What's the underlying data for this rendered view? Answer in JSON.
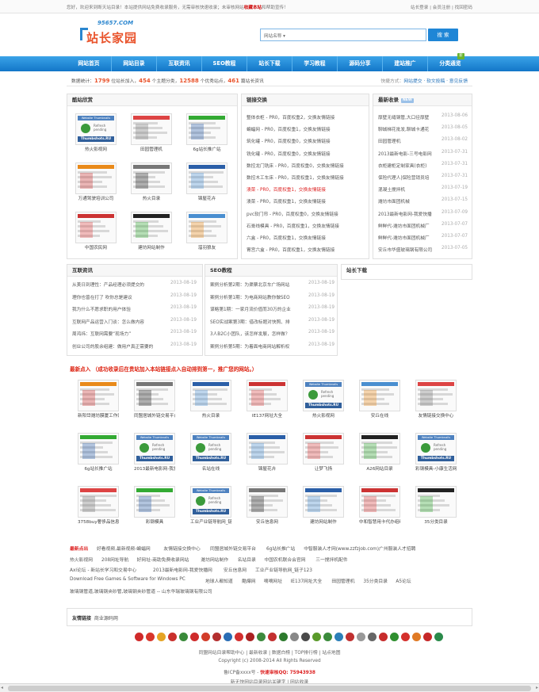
{
  "topbar": {
    "message_pre": "您好，欢迎来到断天站目录！本站提供网站免费收录服务，无需审核快速收录；未审核网站",
    "message_hl": "收藏本站",
    "message_post": "和帮助宣传！",
    "links": "站长登录 | 会员注册 | 找回密码"
  },
  "logo": {
    "url": "95657.COM",
    "name": "站长家园"
  },
  "search": {
    "select_label": "网站名称 ▾",
    "placeholder": "",
    "button": "搜 索"
  },
  "nav": [
    "网站首页",
    "网站目录",
    "互联资讯",
    "SEO教程",
    "站长下载",
    "学习教程",
    "源码分享",
    "建站推广",
    "分类通览"
  ],
  "nav_badge": "新",
  "stats": {
    "prefix": "数据统计：",
    "sites": "1799",
    "sites_label": "位站长加入，",
    "cats": "454",
    "cats_label": "个主题分类，",
    "excellent": "12588",
    "excellent_label": "个优秀站点，",
    "articles": "461",
    "articles_label": "篇站长资讯",
    "quick_label": "快捷方式：",
    "quick_links": "网站提交 · 软文投稿 · 意见反馈"
  },
  "cool_sites": {
    "title": "酷站欣赏",
    "items": [
      "热火影视网",
      "田园管理机",
      "6g站长推广站",
      "万通驾驶培训公司",
      "热火目录",
      "锦屋花卉",
      "中国农民网",
      "建坊网站制作",
      "溜羽狼友"
    ]
  },
  "link_exchange": {
    "title": "链接交换",
    "items": [
      {
        "t": "整体衣柜 - PR0，百度权重2，交换友情链接",
        "red": false
      },
      {
        "t": "蝙蝠网 - PR0，百度权重1，交换友情链接",
        "red": false
      },
      {
        "t": "筑化罐 - PR0，百度权重0，交换友情链接",
        "red": false
      },
      {
        "t": "铣化罐 - PR0，百度权重0，交换友情链接",
        "red": false
      },
      {
        "t": "数控龙门铣床 - PR0，百度权重0，交换友情链接",
        "red": false
      },
      {
        "t": "数控木工车床 - PR0，百度权重1，交换友情链接",
        "red": false
      },
      {
        "t": "溃菜 - PR0，百度权重1，交换友情链接",
        "red": true
      },
      {
        "t": "溃菜 - PR0，百度权重1，交换友情链接",
        "red": false
      },
      {
        "t": "pvc软门帘 - PR0，百度权重0，交换友情链接",
        "red": false
      },
      {
        "t": "石膏线模具 - PR0，百度权重1，交换友情链接",
        "red": false
      },
      {
        "t": "六盒 - PR0，百度权重1，交换友情链接",
        "red": false
      },
      {
        "t": "胃宫六盒 - PR0，百度权重1，交换友情链接",
        "red": false
      }
    ]
  },
  "newest": {
    "title": "最新收录",
    "tag": "NEW",
    "items": [
      {
        "t": "厚壁无缝钢管,大口径厚壁",
        "d": "2013-08-06"
      },
      {
        "t": "聊城梯花批发,聊城卡通花",
        "d": "2013-08-05"
      },
      {
        "t": "田园管理机",
        "d": "2013-08-02"
      },
      {
        "t": "2013最新电影-三号电影网",
        "d": "2013-07-31"
      },
      {
        "t": "衣柜建柜定制家具(衣柜)",
        "d": "2013-07-31"
      },
      {
        "t": "保险代理人|保险营销员培",
        "d": "2013-07-31"
      },
      {
        "t": "混凝土搅拌机",
        "d": "2013-07-19"
      },
      {
        "t": "潍坊市面团机械",
        "d": "2013-07-15"
      },
      {
        "t": "2013最新电影网-我爱快播",
        "d": "2013-07-09"
      },
      {
        "t": "鲜鲜代-潍坊市面团机械厂",
        "d": "2013-07-07"
      },
      {
        "t": "鲜鲜代-潍坊市面团机械厂",
        "d": "2013-07-07"
      },
      {
        "t": "安丘市华盛玻璃钢有限公司",
        "d": "2013-07-05"
      }
    ]
  },
  "news": {
    "title": "互联资讯",
    "items": [
      {
        "t": "从美日到理性：产品经理必须提交的",
        "d": "2013-08-19"
      },
      {
        "t": "理你也曾在打了 吹你总是建议",
        "d": "2013-08-19"
      },
      {
        "t": "我为什么不愿求职的用户体验",
        "d": "2013-08-19"
      },
      {
        "t": "互联网产品运营入门谈：怎么做内容",
        "d": "2013-08-19"
      },
      {
        "t": "周鸿祎：互联网需要“现场力”",
        "d": "2013-08-19"
      },
      {
        "t": "创业公司的股余组建：做用户真正需要的",
        "d": "2013-08-19"
      }
    ]
  },
  "seo": {
    "title": "SEO教程",
    "items": [
      {
        "t": "案例分析第2期：为渠票北京车广场网站",
        "d": "2013-08-19"
      },
      {
        "t": "案例分析第1期：为电商网站教你做SEO",
        "d": "2013-08-19"
      },
      {
        "t": "谋略第1期：一家月流价值而30万的企业",
        "d": "2013-08-19"
      },
      {
        "t": "SEO实战案第3期：借改标题对快照、排",
        "d": "2013-08-19"
      },
      {
        "t": "3人B2C小团队，该怎样发展，怎样做？",
        "d": "2013-08-19"
      },
      {
        "t": "案例分析第5期：为着面电商网站解析权",
        "d": "2013-08-19"
      }
    ]
  },
  "download": {
    "title": "站长下载"
  },
  "ad_title": "最新点入 （成功收录后在贵站加入本站链接点入自动排到第一，推广您的网站。）",
  "grid": [
    "新阳岱潍坊膜厦工作网",
    "同盟居城外链交易平台",
    "热火目录",
    "IE137网址大全",
    "热火影视网",
    "安丘在线",
    "友情链接交换中心",
    "6g站长推广站",
    "2013最新电影网-我爱",
    "名站在线",
    "锦屋花卉",
    "让梦飞扬",
    "A26网站目录",
    "彩钢模具-小康生活网",
    "3758buy奢侈品信息网",
    "彩钢模具",
    "工业产业链导航网_链",
    "安丘信息网",
    "建坊网站制作",
    "中和智慧用卡代办组织",
    "35分类目录"
  ],
  "textlinks": {
    "label": "最新点出",
    "rows": [
      [
        "好看视频,最新视频-蝙蝠网",
        "友情链接交换中心",
        "同盟居城外链交易平台",
        "6g站长推广站",
        "中智服装人才网(www.zzfzjob.com)广州服装人才招聘"
      ],
      [
        "热火影视网",
        "208网址导航",
        "好网址-商助免费收录网站",
        "潍坊网站制作",
        "名站目录",
        "中国农机联合会官网",
        "三一搅拌机配件"
      ],
      [
        "Axl论坛 - 新站长学习和交易中心",
        "2013最新电影网-我爱快播网",
        "安丘信息网",
        "工业产业链导航网_链子123"
      ],
      [
        "Download Free Games & Software for Windows PC",
        "地球人都知道",
        "酷爆网",
        "嘀嘀网址",
        "IE137网址大全",
        "田园管理机",
        "35分类目录",
        "A5论坛"
      ],
      [
        "玻璃钢管道,玻璃钢夹砂管,玻璃钢夹砂管道 -- 山东华瑞玻璃钢有限公司"
      ]
    ]
  },
  "friend": {
    "label": "友情链接",
    "links": "商业源码网"
  },
  "icon_colors": [
    "#d02a2a",
    "#d8362b",
    "#e5a425",
    "#c9302c",
    "#3a8a3a",
    "#cf2b2b",
    "#d23c2a",
    "#b42f2f",
    "#2a6db5",
    "#d32f2f",
    "#aa2222",
    "#3d8a3d",
    "#c33030",
    "#2d7a2d",
    "#888888",
    "#4a4a4a",
    "#5a9a2a",
    "#3b8b3b",
    "#2c7fb8",
    "#c03030",
    "#999999",
    "#666666",
    "#c72c2c",
    "#2f8f2f",
    "#d4302c",
    "#e07a25",
    "#c62828",
    "#2a8a4a"
  ],
  "footer": {
    "line1": "同盟网站目录帮助中心 | 最新收录 | 数据白榜 | TOP排行榜 | 站点地图",
    "line2": "Copyright (c) 2008-2014 All Rights Reserved",
    "line3_pre": "鲁ICP备xxxx号 - ",
    "line3_qq": "快速审核QQ: 75943938",
    "line4": "新无快网站目录网站关键字 | 网站收录"
  }
}
